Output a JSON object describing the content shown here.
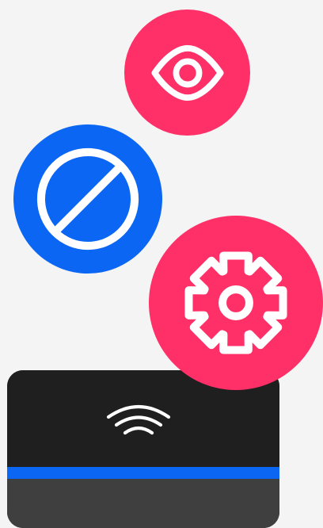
{
  "colors": {
    "background": "#f4f4f4",
    "eye_circle": "#ff2f68",
    "block_circle": "#0b67f3",
    "gear_circle": "#ff2f68",
    "reader_body": "#1f1f1f",
    "reader_stripe": "#0b67f3",
    "reader_base": "#3f3f3f",
    "glyph": "#ffffff"
  },
  "icons": {
    "eye": "eye-icon",
    "block": "block-icon",
    "gear": "gear-icon",
    "wifi": "wifi-icon"
  }
}
